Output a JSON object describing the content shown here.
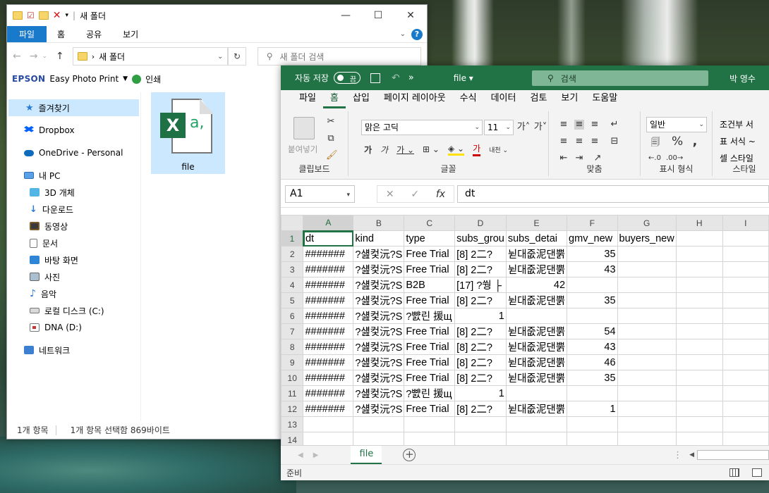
{
  "explorer": {
    "title": "새 폴더",
    "ribbon_tabs": [
      "파일",
      "홈",
      "공유",
      "보기"
    ],
    "address": "새 폴더",
    "search_placeholder": "새 폴더 검색",
    "epson_brand": "EPSON",
    "epson_app": "Easy Photo Print",
    "print_label": "인쇄",
    "sidebar": [
      {
        "label": "즐겨찾기",
        "icon": "star-icon"
      },
      {
        "label": "Dropbox",
        "icon": "dropbox-icon"
      },
      {
        "label": "OneDrive - Personal",
        "icon": "onedrive-icon"
      },
      {
        "label": "내 PC",
        "icon": "pc-icon"
      },
      {
        "label": "3D 개체",
        "icon": "3d-objects-icon"
      },
      {
        "label": "다운로드",
        "icon": "downloads-icon"
      },
      {
        "label": "동영상",
        "icon": "videos-icon"
      },
      {
        "label": "문서",
        "icon": "documents-icon"
      },
      {
        "label": "바탕 화면",
        "icon": "desktop-icon"
      },
      {
        "label": "사진",
        "icon": "pictures-icon"
      },
      {
        "label": "음악",
        "icon": "music-icon"
      },
      {
        "label": "로컬 디스크 (C:)",
        "icon": "local-disk-icon"
      },
      {
        "label": "DNA (D:)",
        "icon": "usb-drive-icon"
      },
      {
        "label": "네트워크",
        "icon": "network-icon"
      }
    ],
    "file": {
      "name": "file",
      "icon": "excel-file-icon"
    },
    "status": {
      "count": "1개 항목",
      "selected": "1개 항목 선택함 869바이트"
    }
  },
  "excel": {
    "autosave_label": "자동 저장",
    "autosave_state": "끔",
    "filename": "file ▾",
    "search_placeholder": "검색",
    "user": "박 영수",
    "ribbon_tabs": [
      "파일",
      "홈",
      "삽입",
      "페이지 레이아웃",
      "수식",
      "데이터",
      "검토",
      "보기",
      "도움말"
    ],
    "active_tab": "홈",
    "groups": {
      "clipboard": "클립보드",
      "font": "글꼴",
      "alignment": "맞춤",
      "number": "표시 형식",
      "styles": "스타일"
    },
    "paste_label": "붙여넣기",
    "font_name": "맑은 고딕",
    "font_size": "11",
    "number_format": "일반",
    "styles_items": [
      "조건부 서",
      "표 서식 ~",
      "셀 스타일"
    ],
    "name_box": "A1",
    "formula": "dt",
    "columns": [
      "A",
      "B",
      "C",
      "D",
      "E",
      "F",
      "G",
      "H",
      "I"
    ],
    "rows": [
      {
        "n": "1",
        "cells": [
          "dt",
          "kind",
          "type",
          "subs_grou",
          "subs_detai",
          "gmv_new",
          "buyers_new",
          "",
          ""
        ]
      },
      {
        "n": "2",
        "cells": [
          "#######",
          "?섎컻沅?S",
          "Free Trial",
          "[8] 2二?",
          "뉟대줎泥댄뿕",
          "35",
          "",
          "",
          ""
        ]
      },
      {
        "n": "3",
        "cells": [
          "#######",
          "?섎컻沅?S",
          "Free Trial",
          "[8] 2二?",
          "뉟대줎泥댄뿕",
          "43",
          "",
          "",
          ""
        ]
      },
      {
        "n": "4",
        "cells": [
          "#######",
          "?섎컻沅?S",
          "B2B",
          "[17] ?쒕 ├",
          "42",
          "",
          "",
          "",
          ""
        ]
      },
      {
        "n": "5",
        "cells": [
          "#######",
          "?섎컻沅?S",
          "Free Trial",
          "[8] 2二?",
          "뉟대줎泥댄뿕",
          "35",
          "",
          "",
          ""
        ]
      },
      {
        "n": "6",
        "cells": [
          "#######",
          "?섎컻沅?S",
          "?뺤린 援щ",
          "1",
          "",
          "",
          "",
          "",
          ""
        ]
      },
      {
        "n": "7",
        "cells": [
          "#######",
          "?섎컻沅?S",
          "Free Trial",
          "[8] 2二?",
          "뉟대줎泥댄뿕",
          "54",
          "",
          "",
          ""
        ]
      },
      {
        "n": "8",
        "cells": [
          "#######",
          "?섎컻沅?S",
          "Free Trial",
          "[8] 2二?",
          "뉟대줎泥댄뿕",
          "43",
          "",
          "",
          ""
        ]
      },
      {
        "n": "9",
        "cells": [
          "#######",
          "?섎컻沅?S",
          "Free Trial",
          "[8] 2二?",
          "뉟대줎泥댄뿕",
          "46",
          "",
          "",
          ""
        ]
      },
      {
        "n": "10",
        "cells": [
          "#######",
          "?섎컻沅?S",
          "Free Trial",
          "[8] 2二?",
          "뉟대줎泥댄뿕",
          "35",
          "",
          "",
          ""
        ]
      },
      {
        "n": "11",
        "cells": [
          "#######",
          "?섎컻沅?S",
          "?뺤린 援щ",
          "1",
          "",
          "",
          "",
          "",
          ""
        ]
      },
      {
        "n": "12",
        "cells": [
          "#######",
          "?섎컻沅?S",
          "Free Trial",
          "[8] 2二?",
          "뉟대줎泥댄뿕",
          "1",
          "",
          "",
          ""
        ]
      },
      {
        "n": "13",
        "cells": [
          "",
          "",
          "",
          "",
          "",
          "",
          "",
          "",
          ""
        ]
      },
      {
        "n": "14",
        "cells": [
          "",
          "",
          "",
          "",
          "",
          "",
          "",
          "",
          ""
        ]
      }
    ],
    "sheet_tab": "file",
    "status": "준비"
  }
}
